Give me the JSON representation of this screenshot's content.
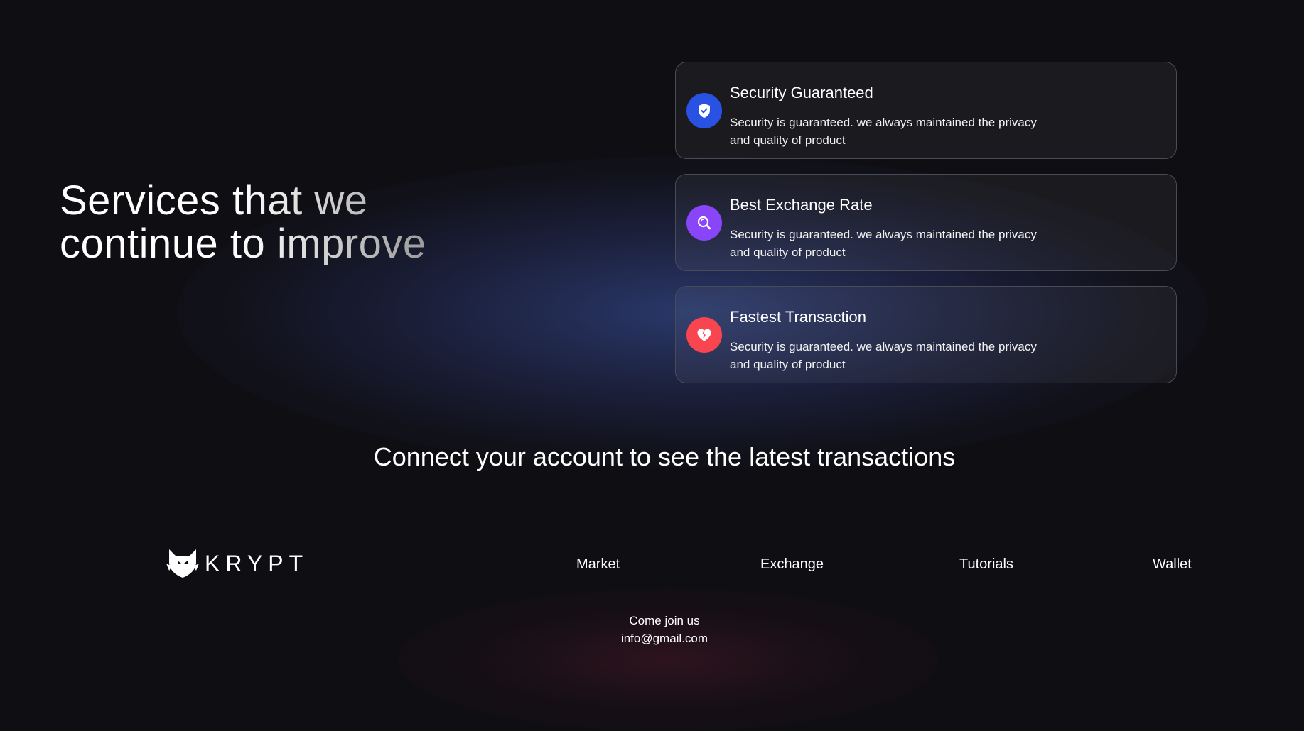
{
  "services": {
    "heading_line1": "Services that we",
    "heading_line2": "continue to improve",
    "cards": [
      {
        "title": "Security Guaranteed",
        "description": "Security is guaranteed. we always maintained the privacy and quality of product",
        "icon": "shield-check-icon",
        "icon_color": "#2952e3"
      },
      {
        "title": "Best Exchange Rate",
        "description": "Security is guaranteed. we always maintained the privacy and quality of product",
        "icon": "search-icon",
        "icon_color": "#8945f8"
      },
      {
        "title": "Fastest Transaction",
        "description": "Security is guaranteed. we always maintained the privacy and quality of product",
        "icon": "heart-icon",
        "icon_color": "#f84550"
      }
    ]
  },
  "transactions": {
    "connect_prompt": "Connect your account to see the latest transactions"
  },
  "footer": {
    "logo_text": "KRYPT",
    "links": [
      "Market",
      "Exchange",
      "Tutorials",
      "Wallet"
    ],
    "join_text": "Come join us",
    "email": "info@gmail.com"
  },
  "colors": {
    "background": "#0f0e13",
    "card_border": "#4a4c55",
    "glow": "#2b3a6e"
  }
}
